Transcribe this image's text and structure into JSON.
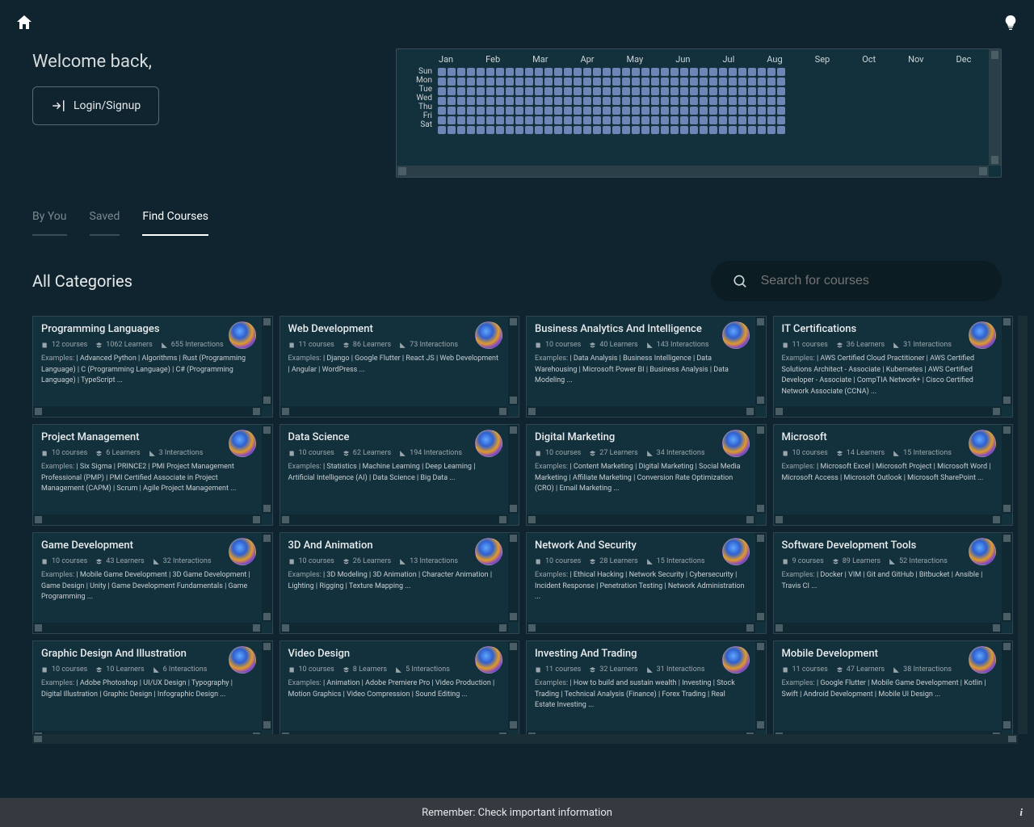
{
  "topbar": {
    "home_icon": "home-icon",
    "bulb_icon": "lightbulb-icon"
  },
  "welcome": {
    "title": "Welcome back,",
    "login_label": "Login/Signup"
  },
  "heatmap": {
    "months": [
      "Jan",
      "Feb",
      "Mar",
      "Apr",
      "May",
      "Jun",
      "Jul",
      "Aug",
      "Sep",
      "Oct",
      "Nov",
      "Dec"
    ],
    "days": [
      "Sun",
      "Mon",
      "Tue",
      "Wed",
      "Thu",
      "Fri",
      "Sat"
    ],
    "weeks": 36
  },
  "tabs": [
    {
      "label": "By You",
      "active": false
    },
    {
      "label": "Saved",
      "active": false
    },
    {
      "label": "Find Courses",
      "active": true
    }
  ],
  "section_title": "All Categories",
  "search": {
    "placeholder": "Search for courses",
    "value": ""
  },
  "stats_labels": {
    "courses": "courses",
    "learners": "Learners",
    "interactions": "Interactions",
    "examples": "Examples:"
  },
  "cards": [
    {
      "title": "Programming Languages",
      "courses": 12,
      "learners": 1062,
      "interactions": 655,
      "examples": [
        "Advanced Python",
        "Algorithms",
        "Rust (Programming Language)",
        "C (Programming Language)",
        "C# (Programming Language)",
        "TypeScript"
      ],
      "more": true
    },
    {
      "title": "Web Development",
      "courses": 11,
      "learners": 86,
      "interactions": 73,
      "examples": [
        "Django",
        "Google Flutter",
        "React JS",
        "Web Development",
        "Angular",
        "WordPress"
      ],
      "more": true
    },
    {
      "title": "Business Analytics And Intelligence",
      "courses": 10,
      "learners": 40,
      "interactions": 143,
      "examples": [
        "Data Analysis",
        "Business Intelligence",
        "Data Warehousing",
        "Microsoft Power BI",
        "Business Analysis",
        "Data Modeling"
      ],
      "more": true
    },
    {
      "title": "IT Certifications",
      "courses": 11,
      "learners": 36,
      "interactions": 31,
      "examples": [
        "AWS Certified Cloud Practitioner",
        "AWS Certified Solutions Architect - Associate",
        "Kubernetes",
        "AWS Certified Developer - Associate",
        "CompTIA Network+",
        "Cisco Certified Network Associate (CCNA)"
      ],
      "more": true
    },
    {
      "title": "Project Management",
      "courses": 10,
      "learners": 6,
      "interactions": 3,
      "examples": [
        "Six Sigma",
        "PRINCE2",
        "PMI Project Management Professional (PMP)",
        "PMI Certified Associate in Project Management (CAPM)",
        "Scrum",
        "Agile Project Management"
      ],
      "more": true
    },
    {
      "title": "Data Science",
      "courses": 10,
      "learners": 62,
      "interactions": 194,
      "examples": [
        "Statistics",
        "Machine Learning",
        "Deep Learning",
        "Artificial Intelligence (AI)",
        "Data Science",
        "Big Data"
      ],
      "more": true
    },
    {
      "title": "Digital Marketing",
      "courses": 10,
      "learners": 27,
      "interactions": 34,
      "examples": [
        "Content Marketing",
        "Digital Marketing",
        "Social Media Marketing",
        "Affiliate Marketing",
        "Conversion Rate Optimization (CRO)",
        "Email Marketing"
      ],
      "more": true
    },
    {
      "title": "Microsoft",
      "courses": 10,
      "learners": 14,
      "interactions": 15,
      "examples": [
        "Microsoft Excel",
        "Microsoft Project",
        "Microsoft Word",
        "Microsoft Access",
        "Microsoft Outlook",
        "Microsoft SharePoint"
      ],
      "more": true
    },
    {
      "title": "Game Development",
      "courses": 10,
      "learners": 43,
      "interactions": 32,
      "examples": [
        "Mobile Game Development",
        "3D Game Development",
        "Game Design",
        "Unity",
        "Game Development Fundamentals",
        "Game Programming"
      ],
      "more": true
    },
    {
      "title": "3D And Animation",
      "courses": 10,
      "learners": 26,
      "interactions": 13,
      "examples": [
        "3D Modeling",
        "3D Animation",
        "Character Animation",
        "Lighting",
        "Rigging",
        "Texture Mapping"
      ],
      "more": true
    },
    {
      "title": "Network And Security",
      "courses": 10,
      "learners": 28,
      "interactions": 15,
      "examples": [
        "Ethical Hacking",
        "Network Security",
        "Cybersecurity",
        "Incident Response",
        "Penetration Testing",
        "Network Administration"
      ],
      "more": true
    },
    {
      "title": "Software Development Tools",
      "courses": 9,
      "learners": 89,
      "interactions": 52,
      "examples": [
        "Docker",
        "VIM",
        "Git and GitHub",
        "Bitbucket",
        "Ansible",
        "Travis CI"
      ],
      "more": true
    },
    {
      "title": "Graphic Design And Illustration",
      "courses": 10,
      "learners": 10,
      "interactions": 6,
      "examples": [
        "Adobe Photoshop",
        "UI/UX Design",
        "Typography",
        "Digital Illustration",
        "Graphic Design",
        "Infographic Design"
      ],
      "more": true
    },
    {
      "title": "Video Design",
      "courses": 10,
      "learners": 8,
      "interactions": 5,
      "examples": [
        "Animation",
        "Adobe Premiere Pro",
        "Video Production",
        "Motion Graphics",
        "Video Compression",
        "Sound Editing"
      ],
      "more": true
    },
    {
      "title": "Investing And Trading",
      "courses": 11,
      "learners": 32,
      "interactions": 31,
      "examples": [
        "How to build and sustain wealth",
        "Investing",
        "Stock Trading",
        "Technical Analysis (Finance)",
        "Forex Trading",
        "Real Estate Investing"
      ],
      "more": true
    },
    {
      "title": "Mobile Development",
      "courses": 11,
      "learners": 47,
      "interactions": 38,
      "examples": [
        "Google Flutter",
        "Mobile Game Development",
        "Kotlin",
        "Swift",
        "Android Development",
        "Mobile UI Design"
      ],
      "more": true
    }
  ],
  "footer": {
    "text": "Remember: Check important information",
    "info_glyph": "i"
  }
}
